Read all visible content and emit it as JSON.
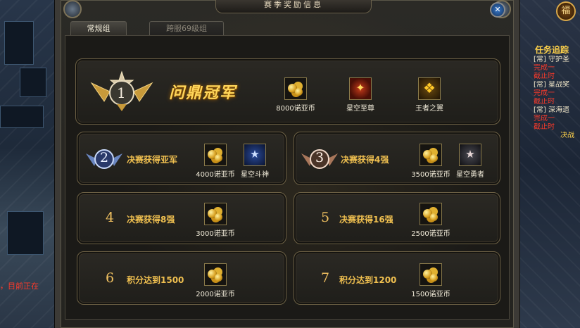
{
  "window": {
    "title": "赛季奖励信息",
    "close_icon": "close-icon"
  },
  "tabs": [
    {
      "label": "常规组",
      "active": true
    },
    {
      "label": "跨服69级组",
      "active": false
    }
  ],
  "champion": {
    "rank": "1",
    "title": "问鼎冠军",
    "rewards": [
      {
        "label": "8000诺亚币",
        "icon": "coin-stack-icon"
      },
      {
        "label": "星空至尊",
        "icon": "crest-icon"
      },
      {
        "label": "王者之翼",
        "icon": "wings-icon"
      }
    ]
  },
  "cards": [
    {
      "rank": "2",
      "condition": "决赛获得亚军",
      "rewards": [
        {
          "label": "4000诺亚币",
          "icon": "coin-stack-icon"
        },
        {
          "label": "星空斗神",
          "icon": "badge-icon"
        }
      ]
    },
    {
      "rank": "3",
      "condition": "决赛获得4强",
      "rewards": [
        {
          "label": "3500诺亚币",
          "icon": "coin-stack-icon"
        },
        {
          "label": "星空勇者",
          "icon": "badge-icon"
        }
      ]
    },
    {
      "rank": "4",
      "condition": "决赛获得8强",
      "rewards": [
        {
          "label": "3000诺亚币",
          "icon": "coin-stack-icon"
        }
      ]
    },
    {
      "rank": "5",
      "condition": "决赛获得16强",
      "rewards": [
        {
          "label": "2500诺亚币",
          "icon": "coin-stack-icon"
        }
      ]
    },
    {
      "rank": "6",
      "condition": "积分达到1500",
      "rewards": [
        {
          "label": "2000诺亚币",
          "icon": "coin-stack-icon"
        }
      ]
    },
    {
      "rank": "7",
      "condition": "积分达到1200",
      "rewards": [
        {
          "label": "1500诺亚币",
          "icon": "coin-stack-icon"
        }
      ]
    }
  ],
  "side": {
    "fu_label": "福",
    "quest_title": "任务追踪",
    "quest_lines": [
      "[常] 守护圣",
      "完成一",
      "截止时",
      "[常] 星战奖",
      "完成一",
      "截止时",
      "[常] 深海遗",
      "完成一",
      "截止时",
      "决战"
    ],
    "left_text": "，目前正在"
  }
}
